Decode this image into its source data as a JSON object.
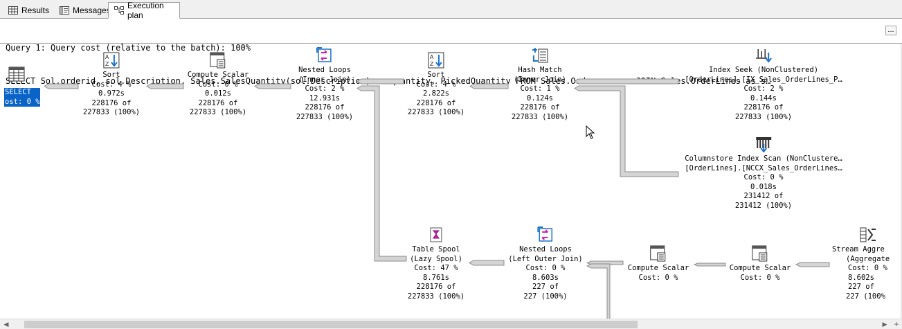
{
  "tabs": [
    {
      "label": "Results",
      "icon": "grid-icon"
    },
    {
      "label": "Messages",
      "icon": "messages-icon"
    },
    {
      "label": "Execution plan",
      "icon": "execution-plan-icon",
      "active": true
    }
  ],
  "header": {
    "line1": "Query 1: Query cost (relative to the batch): 100%",
    "line2": "SELECT Sol.orderid, sol.Description, Sales.SalesQuantity(sol.Description) as quantity, PickedQuantity FROM Sales.Orders as so JOIN Sales.OrderLines as s…",
    "more_button": "..."
  },
  "plan": {
    "select": {
      "line1": "SELECT",
      "line2": "ost: 0 %"
    },
    "sort1": {
      "lines": [
        "Sort",
        "Cost: 4 %",
        "0.972s",
        "228176 of",
        "227833 (100%)"
      ]
    },
    "compute1": {
      "lines": [
        "Compute Scalar",
        "Cost: 0 %",
        "0.012s",
        "228176 of",
        "227833 (100%)"
      ]
    },
    "nested1": {
      "lines": [
        "Nested Loops",
        "(Inner Join)",
        "Cost: 2 %",
        "12.931s",
        "228176 of",
        "227833 (100%)"
      ]
    },
    "sort2": {
      "lines": [
        "Sort",
        "Cost: 4 %",
        "2.822s",
        "228176 of",
        "227833 (100%)"
      ]
    },
    "hash": {
      "lines": [
        "Hash Match",
        "(Inner Join)",
        "Cost: 1 %",
        "0.124s",
        "228176 of",
        "227833 (100%)"
      ]
    },
    "seek": {
      "lines": [
        "Index Seek (NonClustered)",
        "[OrderLines].[IX_Sales_OrderLines_P…",
        "Cost: 2 %",
        "0.144s",
        "228176 of",
        "227833 (100%)"
      ]
    },
    "colscan": {
      "lines": [
        "Columnstore Index Scan (NonClustere…",
        "[OrderLines].[NCCX_Sales_OrderLines…",
        "Cost: 0 %",
        "0.018s",
        "231412 of",
        "231412 (100%)"
      ]
    },
    "spool": {
      "lines": [
        "Table Spool",
        "(Lazy Spool)",
        "Cost: 47 %",
        "8.761s",
        "228176 of",
        "227833 (100%)"
      ]
    },
    "nested2": {
      "lines": [
        "Nested Loops",
        "(Left Outer Join)",
        "Cost: 0 %",
        "8.603s",
        "227 of",
        "227 (100%)"
      ]
    },
    "compute2": {
      "lines": [
        "Compute Scalar",
        "Cost: 0 %"
      ]
    },
    "compute3": {
      "lines": [
        "Compute Scalar",
        "Cost: 0 %"
      ]
    },
    "stream": {
      "lines": [
        "Stream Aggre",
        "(Aggregate",
        "Cost: 0 %",
        "8.602s",
        "227 of",
        "227 (100%"
      ]
    }
  },
  "colors": {
    "selection": "#0a64c8",
    "connector": "#d4d4d4",
    "connector_edge": "#8c8c8c",
    "tab_bg": "#f0f0f0"
  }
}
